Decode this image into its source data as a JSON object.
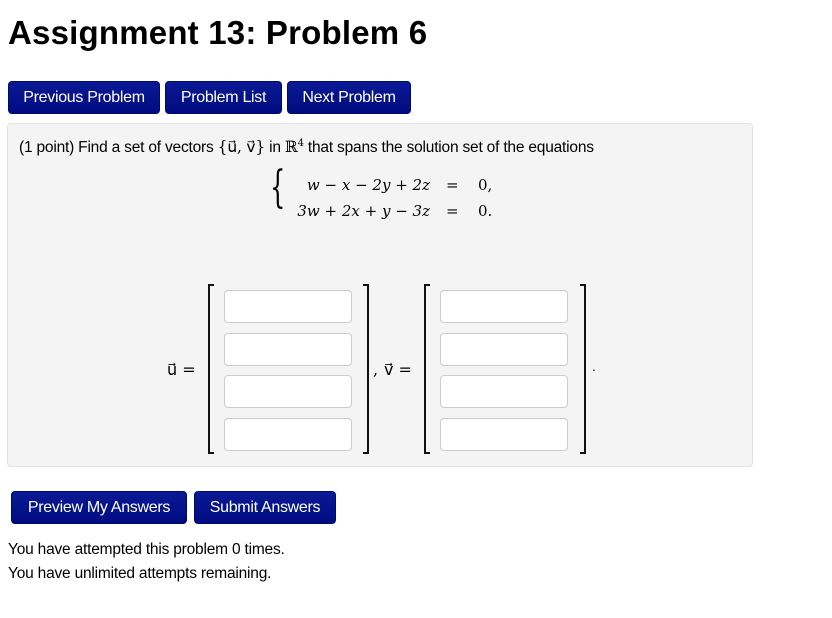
{
  "page": {
    "title": "Assignment 13: Problem 6"
  },
  "nav": {
    "previous_label": "Previous Problem",
    "list_label": "Problem List",
    "next_label": "Next Problem"
  },
  "problem": {
    "points": "(1 point)",
    "prompt_before": "Find a set of vectors",
    "set_expr": "{u⃗, v⃗}",
    "in_text": "in",
    "space": "ℝ",
    "space_exp": "4",
    "prompt_after": "that spans the solution set of the equations",
    "equations": [
      {
        "lhs": "w − x − 2y + 2z",
        "eq": "=",
        "rhs": "0,"
      },
      {
        "lhs": "3w + 2x + y − 3z",
        "eq": "=",
        "rhs": "0."
      }
    ],
    "vector_u_label": "u⃗ =",
    "separator": ",",
    "vector_v_label": "v⃗ =",
    "end_period": ".",
    "u_entries": [
      "",
      "",
      "",
      ""
    ],
    "v_entries": [
      "",
      "",
      "",
      ""
    ]
  },
  "actions": {
    "preview_label": "Preview My Answers",
    "submit_label": "Submit Answers"
  },
  "status": {
    "attempts_line": "You have attempted this problem 0 times.",
    "remaining_line": "You have unlimited attempts remaining."
  }
}
